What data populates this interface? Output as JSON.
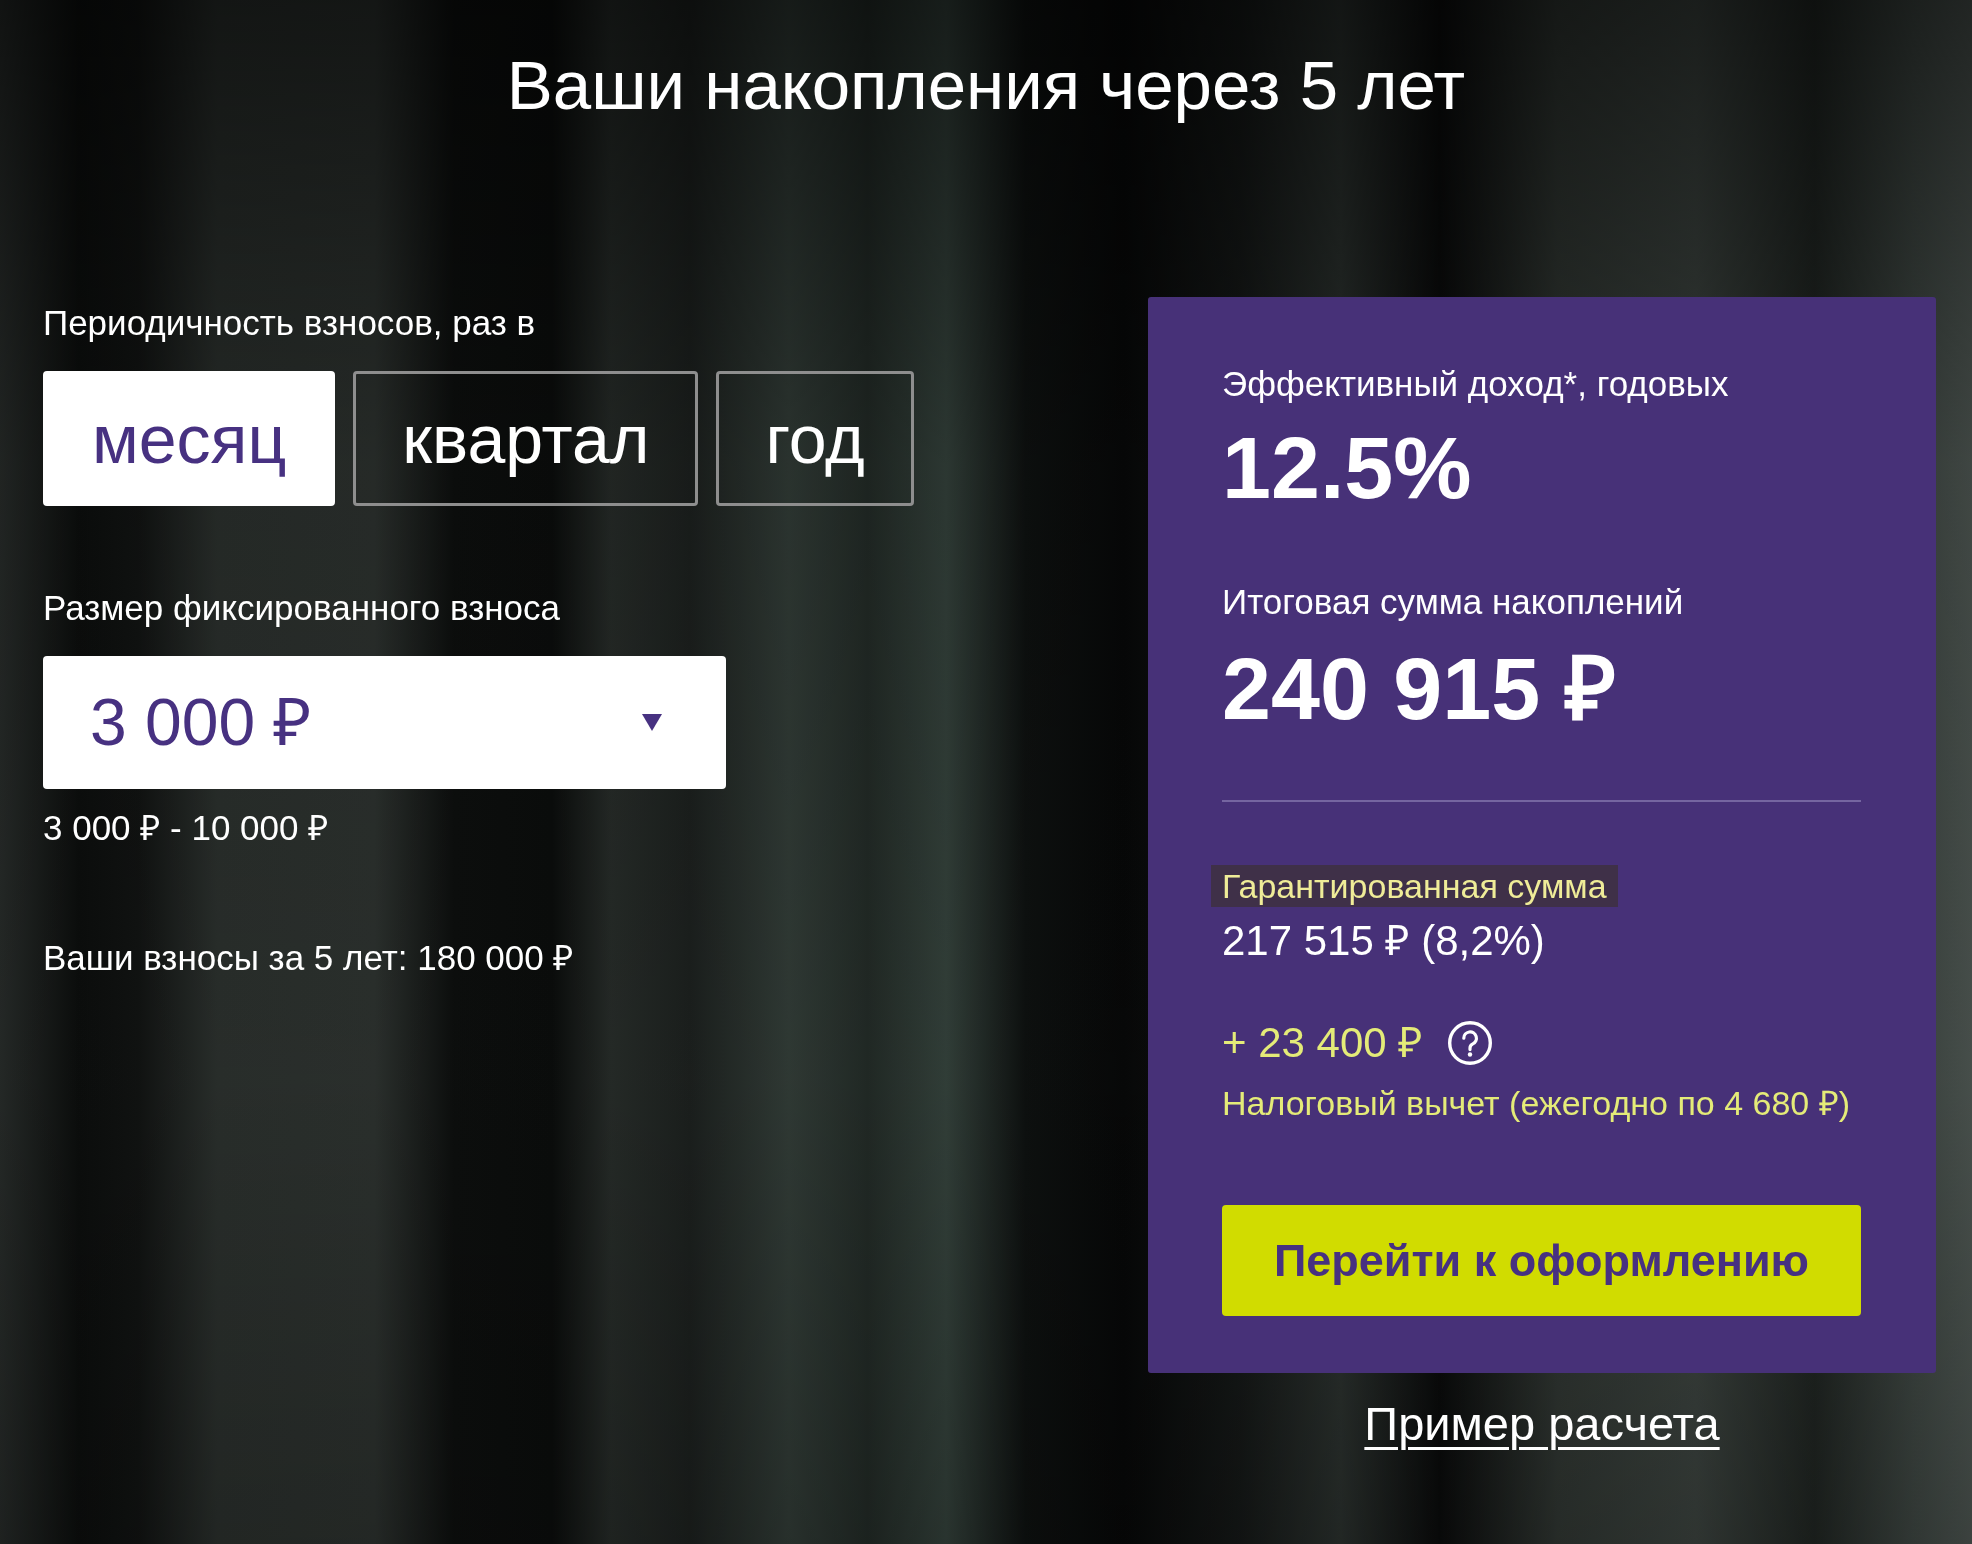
{
  "header": {
    "title": "Ваши накопления через 5 лет"
  },
  "frequency": {
    "label": "Периодичность взносов, раз в",
    "options": [
      {
        "label": "месяц",
        "selected": true
      },
      {
        "label": "квартал",
        "selected": false
      },
      {
        "label": "год",
        "selected": false
      }
    ]
  },
  "contribution": {
    "label": "Размер фиксированного взноса",
    "value": "3 000 ₽",
    "range": "3 000 ₽ - 10 000 ₽"
  },
  "total_contributions": "Ваши взносы за 5 лет: 180 000 ₽",
  "result_card": {
    "yield_label": "Эффективный доход*, годовых",
    "yield_value": "12.5%",
    "total_label": "Итоговая сумма накоплений",
    "total_value": "240 915 ₽",
    "guaranteed": {
      "label": "Гарантированная сумма",
      "value": "217 515 ₽ (8,2%)"
    },
    "tax_deduction": {
      "amount": "+ 23 400 ₽",
      "note": "Налоговый вычет (ежегодно по 4 680 ₽)"
    },
    "action_button": "Перейти к оформлению"
  },
  "example_link": "Пример расчета"
}
